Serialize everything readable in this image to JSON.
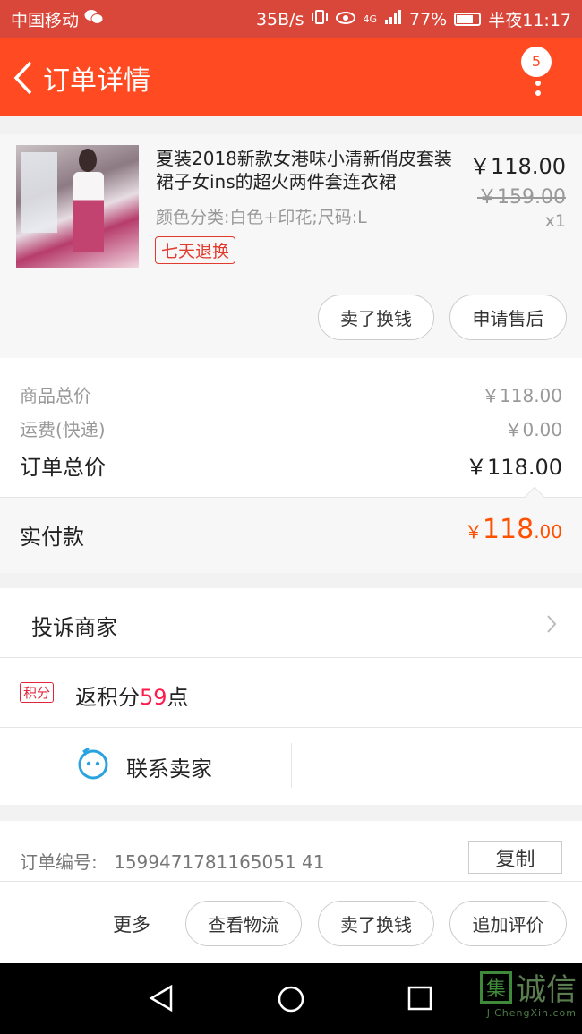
{
  "status_bar": {
    "carrier": "中国移动",
    "speed": "35B/s",
    "network": "4G",
    "battery": "77%",
    "time": "半夜11:17"
  },
  "header": {
    "title": "订单详情",
    "badge_count": "5"
  },
  "product": {
    "title": "夏装2018新款女港味小清新俏皮套装裙子女ins的超火两件套连衣裙",
    "spec": "颜色分类:白色+印花;尺码:L",
    "tag": "七天退换",
    "price": "￥118.00",
    "original_price": "￥159.00",
    "quantity": "x1",
    "buttons": {
      "sell": "卖了换钱",
      "after_sale": "申请售后"
    }
  },
  "summary": {
    "goods_total_label": "商品总价",
    "goods_total_value": "￥118.00",
    "shipping_label": "运费(快递)",
    "shipping_value": "￥0.00",
    "order_total_label": "订单总价",
    "order_total_value": "￥118.00"
  },
  "paid": {
    "label": "实付款",
    "currency": "￥",
    "integer": "118",
    "decimal": ".00"
  },
  "complain": {
    "label": "投诉商家"
  },
  "points": {
    "tag": "积分",
    "prefix": "返积分",
    "number": "59",
    "suffix": "点"
  },
  "contact": {
    "label": "联系卖家"
  },
  "order_info": {
    "number_label": "订单编号:",
    "number_value": "1599471781165051 41",
    "copy": "复制"
  },
  "actions": {
    "more": "更多",
    "logistics": "查看物流",
    "sell": "卖了换钱",
    "review": "追加评价"
  },
  "watermark": {
    "logo_char": "集",
    "text": "诚信",
    "subtext": "JiChengXin.com"
  },
  "colors": {
    "status_bar": "#d9473a",
    "header": "#ff4a22",
    "paid_price": "#ff5000",
    "points_number": "#ff1a4b"
  }
}
